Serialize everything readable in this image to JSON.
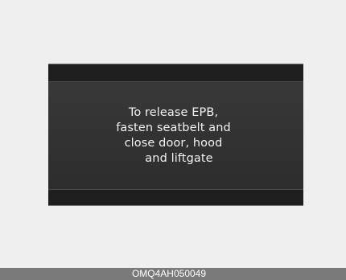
{
  "display": {
    "message_lines": [
      "To release EPB,",
      "fasten seatbelt and",
      "close door, hood",
      "and liftgate"
    ]
  },
  "footer": {
    "code": "OMQ4AH050049"
  },
  "colors": {
    "page_background": "#efefef",
    "display_background": "#2f2f2f",
    "text": "#f2f2f2",
    "footer_bar": "#7a7a7a"
  }
}
